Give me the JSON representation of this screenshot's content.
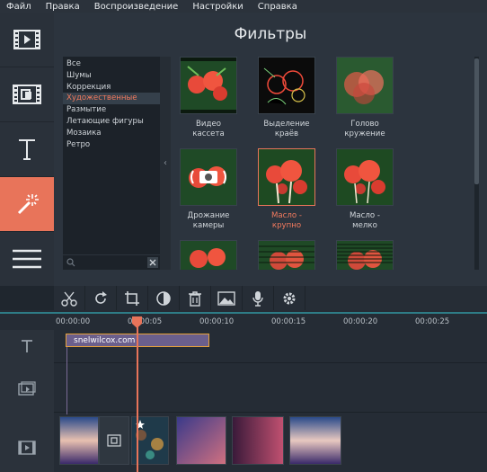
{
  "menu": [
    "Файл",
    "Правка",
    "Воспроизведение",
    "Настройки",
    "Справка"
  ],
  "sidebar": {
    "items": [
      {
        "name": "import-media-tab",
        "icon": "film-strip-icon",
        "active": false
      },
      {
        "name": "transitions-tab",
        "icon": "transition-icon",
        "active": false
      },
      {
        "name": "titles-tab",
        "icon": "text-icon",
        "active": false
      },
      {
        "name": "filters-tab",
        "icon": "magic-wand-icon",
        "active": true
      },
      {
        "name": "more-tab",
        "icon": "menu-icon",
        "active": false
      }
    ]
  },
  "filters_panel": {
    "title": "Фильтры",
    "categories": [
      "Все",
      "Шумы",
      "Коррекция",
      "Художественные",
      "Размытие",
      "Летающие фигуры",
      "Мозаика",
      "Ретро"
    ],
    "selected_category": "Художественные",
    "search_placeholder": "",
    "tiles": [
      {
        "label": "Видео\nкассета",
        "selected": false
      },
      {
        "label": "Выделение\nкраёв",
        "selected": false
      },
      {
        "label": "Голово\nкружение",
        "selected": false
      },
      {
        "label": "Дрожание\nкамеры",
        "selected": false
      },
      {
        "label": "Масло -\nкрупно",
        "selected": true
      },
      {
        "label": "Масло -\nмелко",
        "selected": false
      },
      {
        "label": "",
        "selected": false
      },
      {
        "label": "",
        "selected": false
      },
      {
        "label": "",
        "selected": false
      }
    ]
  },
  "toolbar": {
    "tools": [
      "cut-icon",
      "rotate-icon",
      "crop-icon",
      "color-adjust-icon",
      "delete-icon",
      "image-icon",
      "microphone-icon",
      "settings-gear-icon"
    ]
  },
  "timeline": {
    "ruler_labels": [
      "00:00:00",
      "00:00:05",
      "00:00:10",
      "00:00:15",
      "00:00:20",
      "00:00:25"
    ],
    "title_clip": "snelwilcox.com",
    "colors": {
      "accent": "#e8745a",
      "title_clip": "#6b5f8c",
      "teal_line": "#2e7c86"
    }
  }
}
